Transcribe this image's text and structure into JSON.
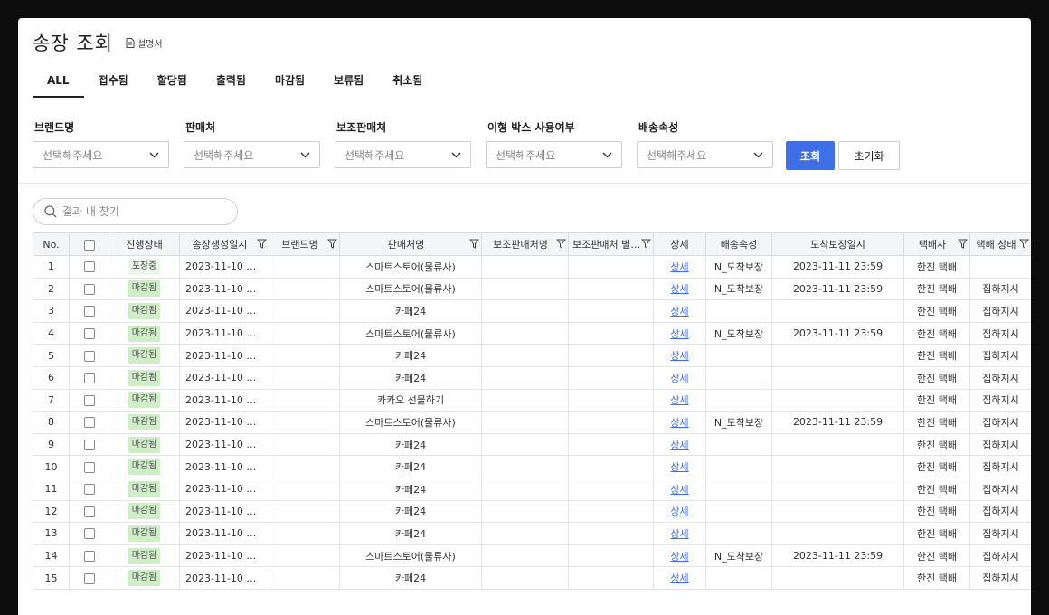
{
  "header": {
    "title": "송장 조회",
    "manual_label": "설명서"
  },
  "tabs": [
    {
      "label": "ALL",
      "active": true
    },
    {
      "label": "접수됨"
    },
    {
      "label": "할당됨"
    },
    {
      "label": "출력됨"
    },
    {
      "label": "마감됨"
    },
    {
      "label": "보류됨"
    },
    {
      "label": "취소됨"
    }
  ],
  "filters": [
    {
      "label": "브랜드명",
      "placeholder": "선택해주세요"
    },
    {
      "label": "판매처",
      "placeholder": "선택해주세요"
    },
    {
      "label": "보조판매처",
      "placeholder": "선택해주세요"
    },
    {
      "label": "이형 박스 사용여부",
      "placeholder": "선택해주세요"
    },
    {
      "label": "배송속성",
      "placeholder": "선택해주세요"
    }
  ],
  "buttons": {
    "search": "조회",
    "reset": "초기화"
  },
  "search": {
    "placeholder": "결과 내 찾기"
  },
  "table": {
    "columns": [
      "No.",
      "",
      "진행상태",
      "송장생성일시",
      "브랜드명",
      "판매처명",
      "보조판매처명",
      "보조판매처 별…",
      "상세",
      "배송속성",
      "도착보장일시",
      "택배사",
      "택배 상태"
    ],
    "rows": [
      {
        "no": "1",
        "status": "포장중",
        "created": "2023-11-10 …",
        "brand": "",
        "seller": "스마트스토어(물류사)",
        "sub_seller": "",
        "sub_seller_alias": "",
        "detail": "상세",
        "attr": "N_도착보장",
        "guarantee": "2023-11-11 23:59",
        "courier": "한진 택배",
        "courier_status": ""
      },
      {
        "no": "2",
        "status": "마감됨",
        "created": "2023-11-10 …",
        "brand": "",
        "seller": "스마트스토어(물류사)",
        "sub_seller": "",
        "sub_seller_alias": "",
        "detail": "상세",
        "attr": "N_도착보장",
        "guarantee": "2023-11-11 23:59",
        "courier": "한진 택배",
        "courier_status": "집하지시"
      },
      {
        "no": "3",
        "status": "마감됨",
        "created": "2023-11-10 …",
        "brand": "",
        "seller": "카페24",
        "sub_seller": "",
        "sub_seller_alias": "",
        "detail": "상세",
        "attr": "",
        "guarantee": "",
        "courier": "한진 택배",
        "courier_status": "집하지시"
      },
      {
        "no": "4",
        "status": "마감됨",
        "created": "2023-11-10 …",
        "brand": "",
        "seller": "스마트스토어(물류사)",
        "sub_seller": "",
        "sub_seller_alias": "",
        "detail": "상세",
        "attr": "N_도착보장",
        "guarantee": "2023-11-11 23:59",
        "courier": "한진 택배",
        "courier_status": "집하지시"
      },
      {
        "no": "5",
        "status": "마감됨",
        "created": "2023-11-10 …",
        "brand": "",
        "seller": "카페24",
        "sub_seller": "",
        "sub_seller_alias": "",
        "detail": "상세",
        "attr": "",
        "guarantee": "",
        "courier": "한진 택배",
        "courier_status": "집하지시"
      },
      {
        "no": "6",
        "status": "마감됨",
        "created": "2023-11-10 …",
        "brand": "",
        "seller": "카페24",
        "sub_seller": "",
        "sub_seller_alias": "",
        "detail": "상세",
        "attr": "",
        "guarantee": "",
        "courier": "한진 택배",
        "courier_status": "집하지시"
      },
      {
        "no": "7",
        "status": "마감됨",
        "created": "2023-11-10 …",
        "brand": "",
        "seller": "카카오 선물하기",
        "sub_seller": "",
        "sub_seller_alias": "",
        "detail": "상세",
        "attr": "",
        "guarantee": "",
        "courier": "한진 택배",
        "courier_status": "집하지시"
      },
      {
        "no": "8",
        "status": "마감됨",
        "created": "2023-11-10 …",
        "brand": "",
        "seller": "스마트스토어(물류사)",
        "sub_seller": "",
        "sub_seller_alias": "",
        "detail": "상세",
        "attr": "N_도착보장",
        "guarantee": "2023-11-11 23:59",
        "courier": "한진 택배",
        "courier_status": "집하지시"
      },
      {
        "no": "9",
        "status": "마감됨",
        "created": "2023-11-10 …",
        "brand": "",
        "seller": "카페24",
        "sub_seller": "",
        "sub_seller_alias": "",
        "detail": "상세",
        "attr": "",
        "guarantee": "",
        "courier": "한진 택배",
        "courier_status": "집하지시"
      },
      {
        "no": "10",
        "status": "마감됨",
        "created": "2023-11-10 …",
        "brand": "",
        "seller": "카페24",
        "sub_seller": "",
        "sub_seller_alias": "",
        "detail": "상세",
        "attr": "",
        "guarantee": "",
        "courier": "한진 택배",
        "courier_status": "집하지시"
      },
      {
        "no": "11",
        "status": "마감됨",
        "created": "2023-11-10 …",
        "brand": "",
        "seller": "카페24",
        "sub_seller": "",
        "sub_seller_alias": "",
        "detail": "상세",
        "attr": "",
        "guarantee": "",
        "courier": "한진 택배",
        "courier_status": "집하지시"
      },
      {
        "no": "12",
        "status": "마감됨",
        "created": "2023-11-10 …",
        "brand": "",
        "seller": "카페24",
        "sub_seller": "",
        "sub_seller_alias": "",
        "detail": "상세",
        "attr": "",
        "guarantee": "",
        "courier": "한진 택배",
        "courier_status": "집하지시"
      },
      {
        "no": "13",
        "status": "마감됨",
        "created": "2023-11-10 …",
        "brand": "",
        "seller": "카페24",
        "sub_seller": "",
        "sub_seller_alias": "",
        "detail": "상세",
        "attr": "",
        "guarantee": "",
        "courier": "한진 택배",
        "courier_status": "집하지시"
      },
      {
        "no": "14",
        "status": "마감됨",
        "created": "2023-11-10 …",
        "brand": "",
        "seller": "스마트스토어(물류사)",
        "sub_seller": "",
        "sub_seller_alias": "",
        "detail": "상세",
        "attr": "N_도착보장",
        "guarantee": "2023-11-11 23:59",
        "courier": "한진 택배",
        "courier_status": "집하지시"
      },
      {
        "no": "15",
        "status": "마감됨",
        "created": "2023-11-10 …",
        "brand": "",
        "seller": "카페24",
        "sub_seller": "",
        "sub_seller_alias": "",
        "detail": "상세",
        "attr": "",
        "guarantee": "",
        "courier": "한진 택배",
        "courier_status": "집하지시"
      }
    ]
  },
  "colors": {
    "accent": "#3f6fe6",
    "status_closed_bg": "#cfeec8",
    "status_packing_bg": "#eaf6e7",
    "header_bg": "#f4f5f7"
  }
}
